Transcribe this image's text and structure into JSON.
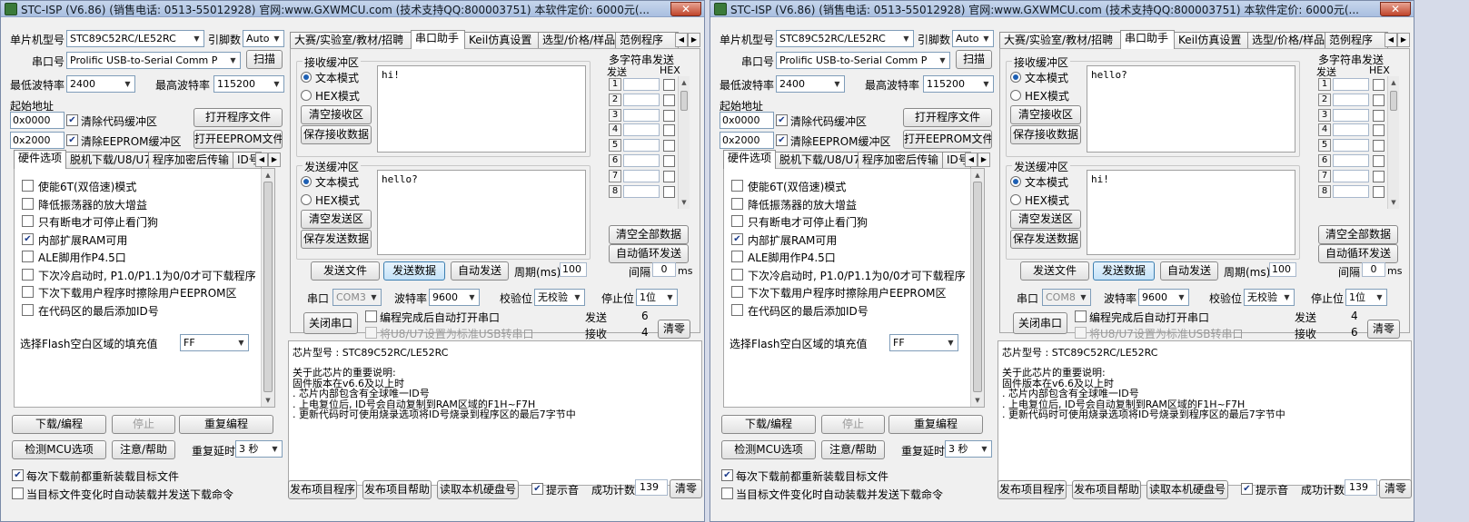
{
  "title": "STC-ISP (V6.86) (销售电话: 0513-55012928) 官网:www.GXWMCU.com  (技术支持QQ:800003751) 本软件定价: 6000元(...",
  "title_short": "STC-ISP (V6.86) (销售电话: 0513-55012928) 官网:www.GXWMCU.com  (技术支持QQ:800003751) 本软件定价: 6000元(...",
  "close_glyph": "✕",
  "common": {
    "mcu_label": "单片机型号",
    "mcu_value": "STC89C52RC/LE52RC",
    "pins_label": "引脚数",
    "pins_value": "Auto",
    "port_label": "串口号",
    "port_value": "Prolific USB-to-Serial Comm P",
    "scan": "扫描",
    "min_baud_label": "最低波特率",
    "min_baud_value": "2400",
    "max_baud_label": "最高波特率",
    "max_baud_value": "115200",
    "start_addr_label": "起始地址",
    "addr1": "0x0000",
    "addr2": "0x2000",
    "clear_code": "清除代码缓冲区",
    "clear_eeprom": "清除EEPROM缓冲区",
    "open_prog": "打开程序文件",
    "open_eeprom": "打开EEPROM文件",
    "hw_tabs": [
      "硬件选项",
      "脱机下载/U8/U7",
      "程序加密后传输",
      "ID号"
    ],
    "hw_options": [
      {
        "label": "使能6T(双倍速)模式",
        "checked": false
      },
      {
        "label": "降低振荡器的放大增益",
        "checked": false
      },
      {
        "label": "只有断电才可停止看门狗",
        "checked": false
      },
      {
        "label": "内部扩展RAM可用",
        "checked": true
      },
      {
        "label": "ALE脚用作P4.5口",
        "checked": false
      },
      {
        "label": "下次冷启动时, P1.0/P1.1为0/0才可下载程序",
        "checked": false
      },
      {
        "label": "下次下载用户程序时擦除用户EEPROM区",
        "checked": false
      },
      {
        "label": "在代码区的最后添加ID号",
        "checked": false
      }
    ],
    "flash_fill_label": "选择Flash空白区域的填充值",
    "flash_fill_value": "FF",
    "download": "下载/编程",
    "stop": "停止",
    "reprogram": "重复编程",
    "detect": "检测MCU选项",
    "help": "注意/帮助",
    "retry_label": "重复延时",
    "retry_value": "3 秒",
    "reload_each": "每次下载前都重新装载目标文件",
    "auto_reload": "当目标文件变化时自动装载并发送下载命令",
    "main_tabs": [
      "大赛/实验室/教材/招聘",
      "串口助手",
      "Keil仿真设置",
      "选型/价格/样品",
      "范例程序"
    ],
    "recv_title": "接收缓冲区",
    "send_title": "发送缓冲区",
    "text_mode": "文本模式",
    "hex_mode": "HEX模式",
    "clear_recv": "清空接收区",
    "save_recv": "保存接收数据",
    "clear_send": "清空发送区",
    "save_send": "保存发送数据",
    "multi_title": "多字符串发送",
    "multi_send": "发送",
    "multi_hex": "HEX",
    "multi_nums": [
      "1",
      "2",
      "3",
      "4",
      "5",
      "6",
      "7",
      "8"
    ],
    "clear_all": "清空全部数据",
    "auto_cycle": "自动循环发送",
    "interval_label": "间隔",
    "interval_value": "0",
    "interval_unit": "ms",
    "send_file": "发送文件",
    "send_data": "发送数据",
    "auto_send": "自动发送",
    "period_label": "周期(ms)",
    "period_value": "100",
    "serial_label": "串口",
    "baud_label": "波特率",
    "baud_value": "9600",
    "parity_label": "校验位",
    "parity_value": "无校验",
    "stop_label": "停止位",
    "stop_value": "1位",
    "close_port": "关闭串口",
    "auto_open": "编程完成后自动打开串口",
    "u8u7": "将U8/U7设置为标准USB转串口",
    "sent_label": "发送",
    "recv_label": "接收",
    "clear": "清零",
    "chip_label": "芯片型号 : STC89C52RC/LE52RC",
    "notes": [
      "关于此芯片的重要说明:",
      "  固件版本在v6.6及以上时",
      "  . 芯片内部包含有全球唯一ID号",
      "  . 上电复位后, ID号会自动复制到RAM区域的F1H~F7H",
      "  . 更新代码时可使用烧录选项将ID号烧录到程序区的最后7字节中"
    ],
    "publish": "发布项目程序",
    "publish_help": "发布项目帮助",
    "read_disk": "读取本机硬盘号",
    "sound": "提示音",
    "success_label": "成功计数",
    "success_value": "139",
    "success_clear": "清零"
  },
  "windows": [
    {
      "recv_text": "hi!",
      "send_text": "hello?",
      "com": "COM3",
      "sent": "6",
      "recv": "4"
    },
    {
      "recv_text": "hello?",
      "send_text": "hi!",
      "com": "COM8",
      "sent": "4",
      "recv": "6"
    }
  ]
}
